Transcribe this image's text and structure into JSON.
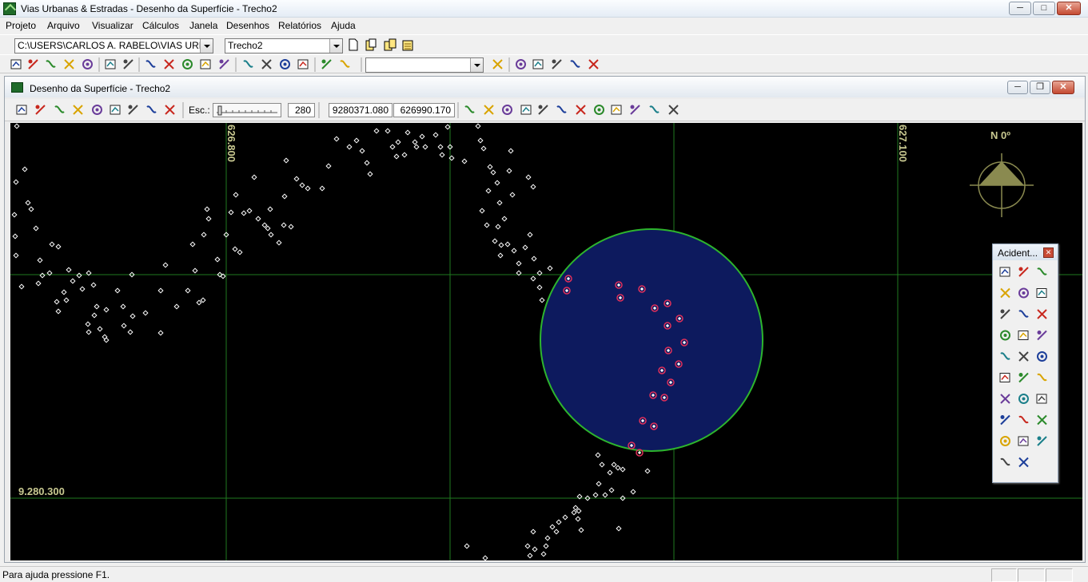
{
  "app": {
    "title": "Vias Urbanas & Estradas -  Desenho da Superfície  - Trecho2",
    "window_buttons": [
      "minimize-button",
      "maximize-button",
      "close-button"
    ]
  },
  "menu": [
    "Projeto",
    "Arquivo",
    "Visualizar",
    "Cálculos",
    "Janela",
    "Desenhos",
    "Relatórios",
    "Ajuda"
  ],
  "toolbar1": {
    "path_value": "C:\\USERS\\CARLOS A. RABELO\\VIAS URBAN",
    "trecho_value": "Trecho2",
    "icons": [
      "new-layer-icon",
      "copy-layer-icon",
      "layers-icon",
      "layers-settings-icon"
    ]
  },
  "toolbar2": {
    "icons": [
      "new-file-icon",
      "open-folder-icon",
      "open-project-icon",
      "save-icon",
      "save-all-icon",
      "help-pointer-icon",
      "help-icon",
      "cut-icon",
      "copy-icon",
      "paste-icon",
      "paste-special-icon",
      "delete-icon",
      "tool-a-icon",
      "tool-b-icon",
      "tool-c-icon",
      "tool-d-icon",
      "tool-e-icon",
      "tool-f-icon"
    ],
    "combo_value": "",
    "right_icons": [
      "print-icon",
      "cascade-windows-icon",
      "tile-vertical-icon",
      "tile-horizontal-icon",
      "arrange-icon",
      "window-list-icon"
    ]
  },
  "drawing_window": {
    "title": "Desenho da Superfície  - Trecho2",
    "scale_label": "Esc.:",
    "scale_value": "280",
    "coord_y": "9280371.080",
    "coord_x": "626990.170",
    "left_icons": [
      "grid-points-icon",
      "locate-point-icon",
      "contour-icon",
      "triangulate-icon",
      "cross-section-icon",
      "axis-icon",
      "flag-icon",
      "hatch-icon",
      "globe-icon"
    ],
    "right_icons": [
      "edit-icon",
      "save-drawing-icon",
      "select-point-icon",
      "zoom-point-icon",
      "zoom-window-icon",
      "zoom-extents-icon",
      "clear-icon",
      "swap-icon",
      "lock-icon",
      "sigma-icon",
      "pan-icon",
      "eraser-icon"
    ]
  },
  "canvas": {
    "grid_labels": {
      "x1": "626.800",
      "x2": "627.100",
      "y1": "9.280.300"
    },
    "north_label": "N 0º",
    "colors": {
      "grid": "#1f7a1f",
      "label": "#c8c890",
      "circle_fill": "#0d1a5e",
      "circle_stroke": "#2db52d",
      "point": "#ffffff",
      "selected": "#e0305a"
    }
  },
  "palette": {
    "title": "Acident...",
    "icons": [
      "bridge-icon",
      "culvert-icon",
      "wall-icon",
      "pole-icon",
      "hydrant-icon",
      "pipe-icon",
      "line-dash-icon",
      "line-slope-icon",
      "curve-icon",
      "curve-b-icon",
      "fence-icon",
      "tree-cross-icon",
      "target-icon",
      "post-icon",
      "sign-icon",
      "tower-icon",
      "cable-icon",
      "line-red-icon",
      "rail-icon",
      "rail-b-icon",
      "dna-icon",
      "tracks-icon",
      "loop-icon",
      "bush-icon",
      "cluster-icon",
      "spiral-icon",
      "circle-dot-icon",
      "segment-icon",
      "funnel-icon"
    ]
  },
  "status": {
    "text": "Para ajuda pressione F1."
  }
}
